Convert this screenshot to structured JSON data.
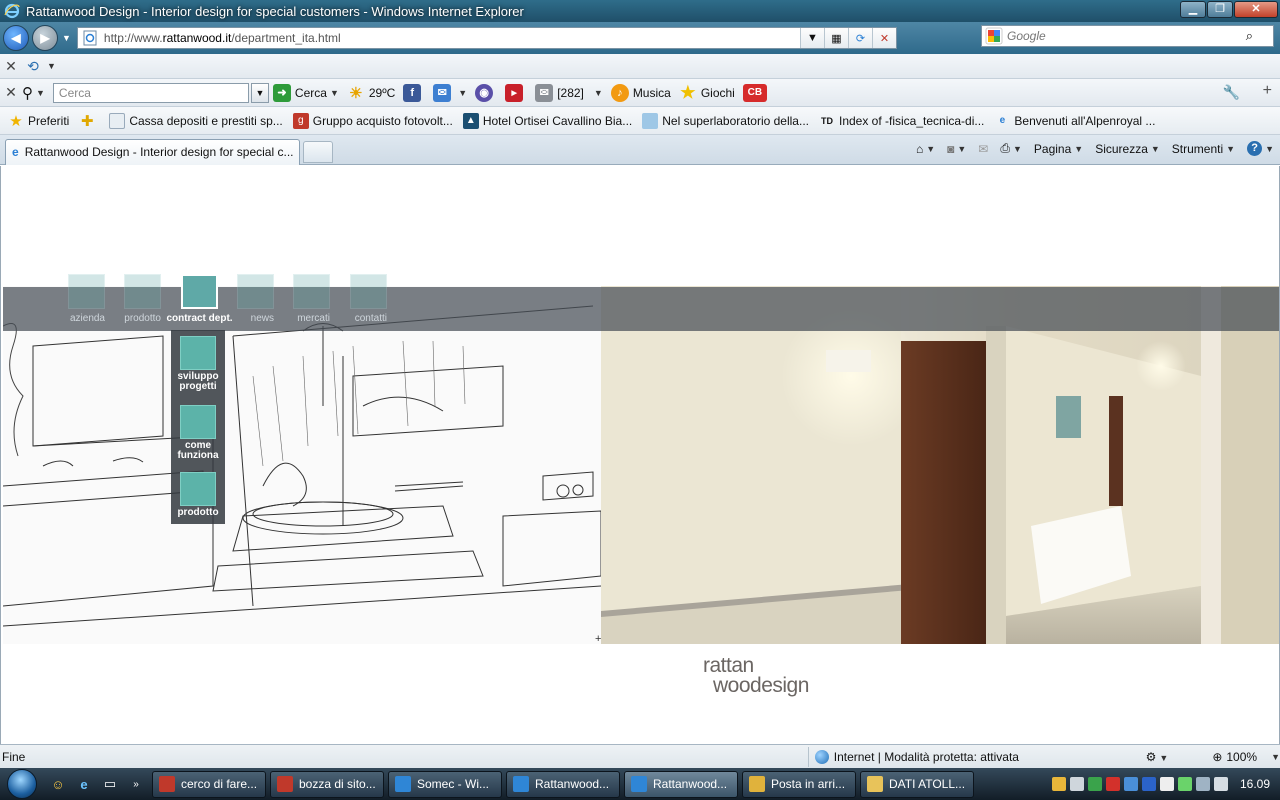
{
  "window": {
    "title": "Rattanwood Design - Interior design for special customers - Windows Internet Explorer"
  },
  "address_bar": {
    "url_prefix": "http://www.",
    "url_domain": "rattanwood.it",
    "url_path": "/department_ita.html"
  },
  "search_box": {
    "placeholder": "Google"
  },
  "toolbar": {
    "search_placeholder": "Cerca",
    "search_button": "Cerca",
    "weather": "29ºC",
    "mail_count": "[282]",
    "music": "Musica",
    "games": "Giochi",
    "cb": "CB"
  },
  "favorites": {
    "label": "Preferiti",
    "items": [
      "Cassa depositi e prestiti sp...",
      "Gruppo acquisto fotovolt...",
      "Hotel Ortisei Cavallino Bia...",
      "Nel superlaboratorio della...",
      "Index of -fisica_tecnica-di...",
      "Benvenuti all'Alpenroyal ..."
    ]
  },
  "tabs": {
    "active": "Rattanwood Design - Interior design for special c..."
  },
  "command_bar": {
    "page": "Pagina",
    "security": "Sicurezza",
    "tools": "Strumenti"
  },
  "site": {
    "menu": [
      "azienda",
      "prodotto",
      "contract dept.",
      "news",
      "mercati",
      "contatti"
    ],
    "active_menu": "contract dept.",
    "submenu": [
      "sviluppo progetti",
      "come funziona",
      "prodotto"
    ],
    "logo_line1": "rattan",
    "logo_line2": "woodesign",
    "colors": {
      "accent": "#5cb3a9",
      "menu_band": "#464e56"
    }
  },
  "statusbar": {
    "status": "Fine",
    "zone": "Internet | Modalità protetta: attivata",
    "zoom": "100%"
  },
  "taskbar": {
    "tasks": [
      "cerco di fare...",
      "bozza di sito...",
      "Somec - Wi...",
      "Rattanwood...",
      "Rattanwood...",
      "Posta in arri...",
      "DATI ATOLL..."
    ],
    "clock": "16.09"
  }
}
